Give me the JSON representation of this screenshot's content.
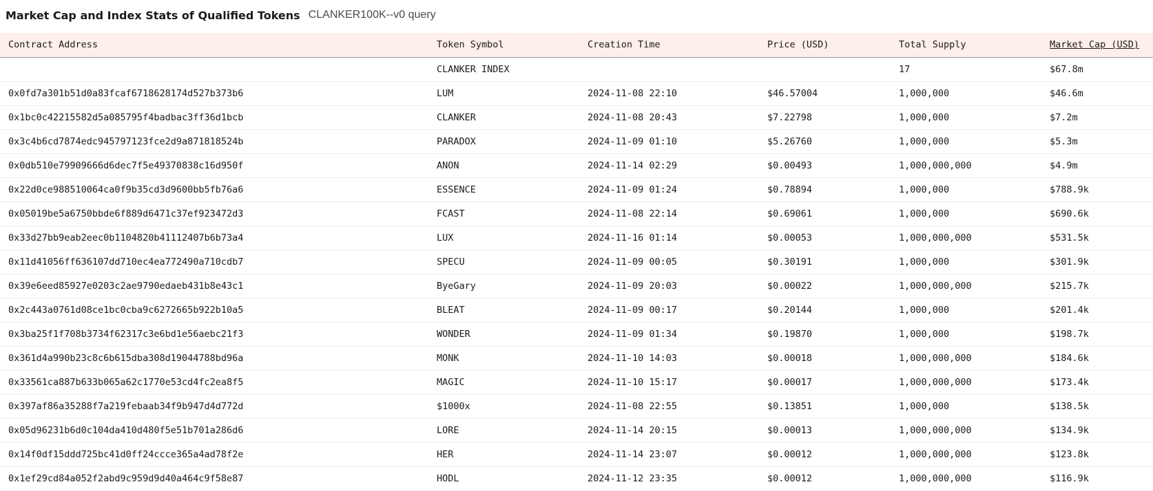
{
  "header": {
    "title": "Market Cap and Index Stats of Qualified Tokens",
    "subtitle": "CLANKER100K--v0 query"
  },
  "table": {
    "columns": [
      "Contract Address",
      "Token Symbol",
      "Creation Time",
      "Price (USD)",
      "Total Supply",
      "Market Cap (USD)"
    ],
    "sorted_column": "Market Cap (USD)",
    "rows": [
      [
        "",
        "CLANKER INDEX",
        "",
        "",
        "17",
        "$67.8m"
      ],
      [
        "0x0fd7a301b51d0a83fcaf6718628174d527b373b6",
        "LUM",
        "2024-11-08 22:10",
        "$46.57004",
        "1,000,000",
        "$46.6m"
      ],
      [
        "0x1bc0c42215582d5a085795f4badbac3ff36d1bcb",
        "CLANKER",
        "2024-11-08 20:43",
        "$7.22798",
        "1,000,000",
        "$7.2m"
      ],
      [
        "0x3c4b6cd7874edc945797123fce2d9a871818524b",
        "PARADOX",
        "2024-11-09 01:10",
        "$5.26760",
        "1,000,000",
        "$5.3m"
      ],
      [
        "0x0db510e79909666d6dec7f5e49370838c16d950f",
        "ANON",
        "2024-11-14 02:29",
        "$0.00493",
        "1,000,000,000",
        "$4.9m"
      ],
      [
        "0x22d0ce988510064ca0f9b35cd3d9600bb5fb76a6",
        "ESSENCE",
        "2024-11-09 01:24",
        "$0.78894",
        "1,000,000",
        "$788.9k"
      ],
      [
        "0x05019be5a6750bbde6f889d6471c37ef923472d3",
        "FCAST",
        "2024-11-08 22:14",
        "$0.69061",
        "1,000,000",
        "$690.6k"
      ],
      [
        "0x33d27bb9eab2eec0b1104820b41112407b6b73a4",
        "LUX",
        "2024-11-16 01:14",
        "$0.00053",
        "1,000,000,000",
        "$531.5k"
      ],
      [
        "0x11d41056ff636107dd710ec4ea772490a710cdb7",
        "SPECU",
        "2024-11-09 00:05",
        "$0.30191",
        "1,000,000",
        "$301.9k"
      ],
      [
        "0x39e6eed85927e0203c2ae9790edaeb431b8e43c1",
        "ByeGary",
        "2024-11-09 20:03",
        "$0.00022",
        "1,000,000,000",
        "$215.7k"
      ],
      [
        "0x2c443a0761d08ce1bc0cba9c6272665b922b10a5",
        "BLEAT",
        "2024-11-09 00:17",
        "$0.20144",
        "1,000,000",
        "$201.4k"
      ],
      [
        "0x3ba25f1f708b3734f62317c3e6bd1e56aebc21f3",
        "WONDER",
        "2024-11-09 01:34",
        "$0.19870",
        "1,000,000",
        "$198.7k"
      ],
      [
        "0x361d4a990b23c8c6b615dba308d19044788bd96a",
        "MONK",
        "2024-11-10 14:03",
        "$0.00018",
        "1,000,000,000",
        "$184.6k"
      ],
      [
        "0x33561ca887b633b065a62c1770e53cd4fc2ea8f5",
        "MAGIC",
        "2024-11-10 15:17",
        "$0.00017",
        "1,000,000,000",
        "$173.4k"
      ],
      [
        "0x397af86a35288f7a219febaab34f9b947d4d772d",
        "$1000x",
        "2024-11-08 22:55",
        "$0.13851",
        "1,000,000",
        "$138.5k"
      ],
      [
        "0x05d96231b6d0c104da410d480f5e51b701a286d6",
        "LORE",
        "2024-11-14 20:15",
        "$0.00013",
        "1,000,000,000",
        "$134.9k"
      ],
      [
        "0x14f0df15ddd725bc41d0ff24ccce365a4ad78f2e",
        "HER",
        "2024-11-14 23:07",
        "$0.00012",
        "1,000,000,000",
        "$123.8k"
      ],
      [
        "0x1ef29cd84a052f2abd9c959d9d40a464c9f58e87",
        "HODL",
        "2024-11-12 23:35",
        "$0.00012",
        "1,000,000,000",
        "$116.9k"
      ]
    ]
  }
}
